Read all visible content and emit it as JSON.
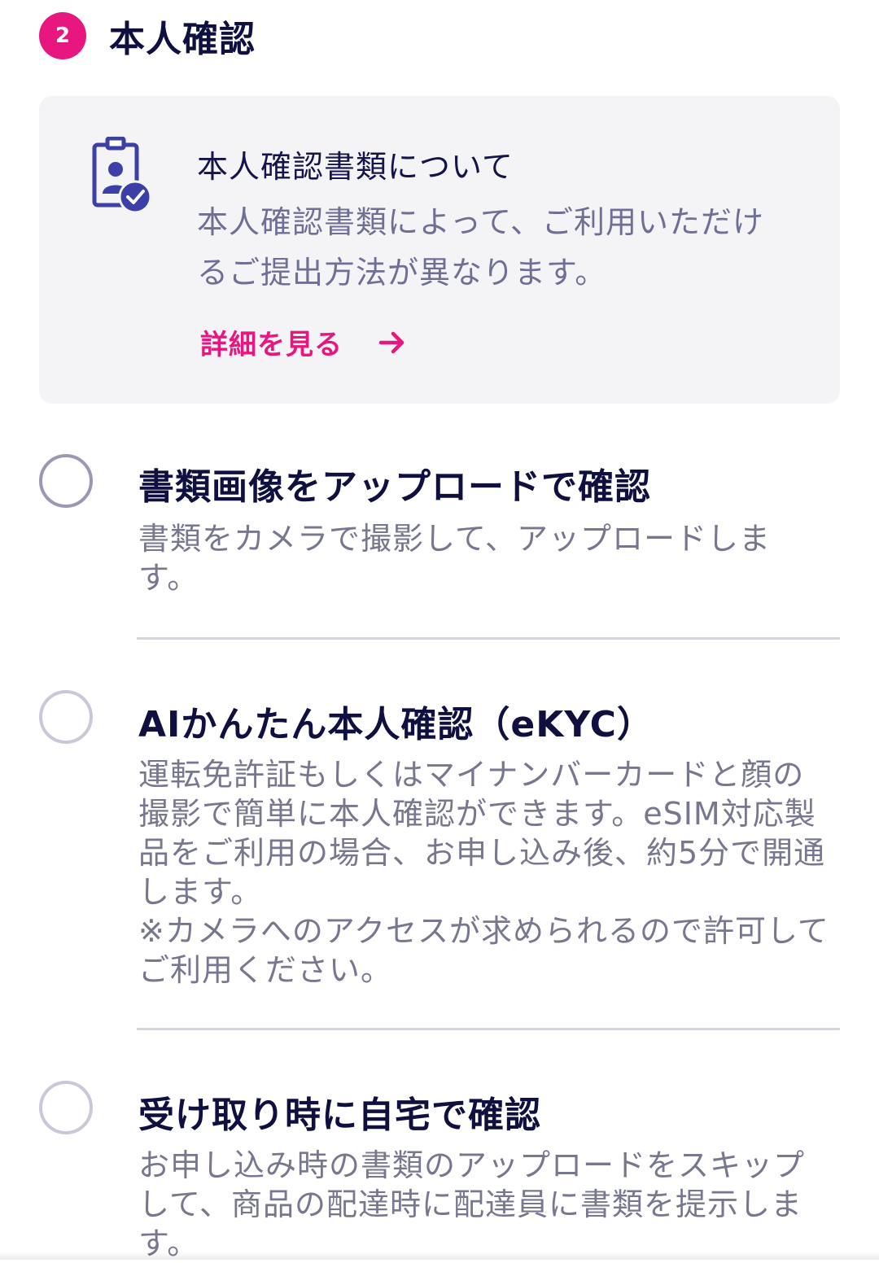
{
  "step": {
    "number": "2",
    "title": "本人確認"
  },
  "info_card": {
    "icon": "id-badge-check-icon",
    "title": "本人確認書類について",
    "description": "本人確認書類によって、ご利用いただけるご提出方法が異なります。",
    "link_label": "詳細を見る",
    "link_icon": "arrow-right-icon"
  },
  "options": [
    {
      "title": "書類画像をアップロードで確認",
      "description": [
        "書類をカメラで撮影して、アップロードします。"
      ],
      "selected": false
    },
    {
      "title": "AIかんたん本人確認（eKYC）",
      "description": [
        "運転免許証もしくはマイナンバーカードと顔の撮影で簡単に本人確認ができます。eSIM対応製品をご利用の場合、お申し込み後、約5分で開通します。",
        "※カメラへのアクセスが求められるので許可してご利用ください。"
      ],
      "selected": false
    },
    {
      "title": "受け取り時に自宅で確認",
      "description": [
        "お申し込み時の書類のアップロードをスキップして、商品の配達時に配達員に書類を提示します。"
      ],
      "selected": false
    }
  ],
  "colors": {
    "accent": "#e8177f",
    "icon_purple": "#3b3fa8",
    "title_text": "#0f1040",
    "muted_text": "#77778f",
    "card_bg": "#f4f4f6"
  }
}
